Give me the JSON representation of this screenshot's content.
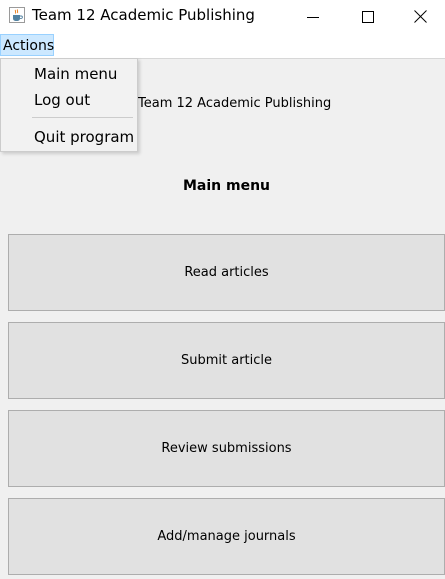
{
  "window": {
    "title": "Team 12 Academic Publishing",
    "controls": [
      "minimize",
      "maximize",
      "close"
    ]
  },
  "menubar": {
    "items": [
      {
        "label": "Actions",
        "open": true
      }
    ]
  },
  "actions_menu": {
    "items": [
      {
        "label": "Main menu"
      },
      {
        "label": "Log out"
      },
      {
        "label": "Quit program"
      }
    ]
  },
  "main": {
    "header": "Team 12 Academic Publishing",
    "title": "Main menu",
    "buttons": [
      {
        "label": "Read articles"
      },
      {
        "label": "Submit article"
      },
      {
        "label": "Review submissions"
      },
      {
        "label": "Add/manage journals"
      }
    ]
  },
  "icons": {
    "app": "java-coffee-cup-icon",
    "minimize": "minimize-icon",
    "maximize": "maximize-icon",
    "close": "close-icon"
  },
  "colors": {
    "background": "#f0f0f0",
    "button_bg": "#e1e1e1",
    "button_border": "#adadad",
    "menu_highlight": "#cce8ff",
    "menu_highlight_border": "#99d1ff"
  }
}
